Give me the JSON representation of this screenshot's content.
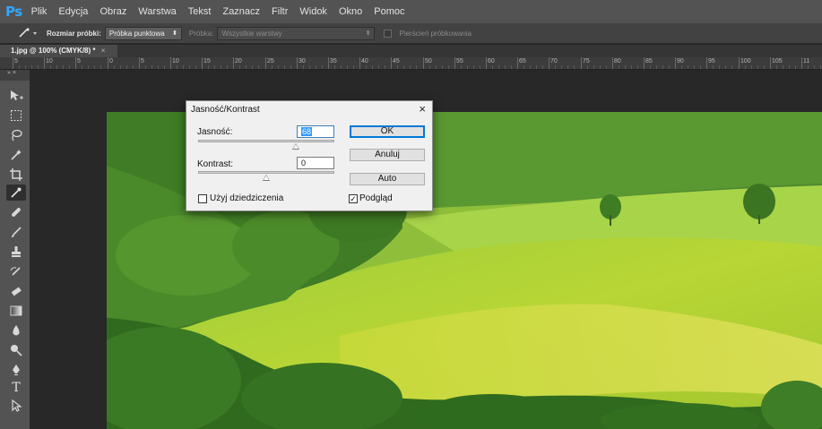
{
  "app": {
    "logo": "Ps"
  },
  "menu": [
    "Plik",
    "Edycja",
    "Obraz",
    "Warstwa",
    "Tekst",
    "Zaznacz",
    "Filtr",
    "Widok",
    "Okno",
    "Pomoc"
  ],
  "options": {
    "sample_size_label": "Rozmiar próbki:",
    "sample_size_value": "Próbka punktowa",
    "sample_label": "Próbka:",
    "sample_value": "Wszystkie warstwy",
    "sampling_ring_label": "Pierścień próbkowania"
  },
  "document": {
    "tab_title": "1.jpg @ 100% (CMYK/8) *",
    "close": "×"
  },
  "ruler": {
    "labels": [
      "5",
      "10",
      "5",
      "0",
      "5",
      "10",
      "15",
      "20",
      "25",
      "30",
      "35",
      "40",
      "45",
      "50",
      "55",
      "60",
      "65",
      "70",
      "75",
      "80",
      "85",
      "90",
      "95",
      "100",
      "105",
      "11"
    ]
  },
  "toolbar": {
    "header": "» ×"
  },
  "dialog": {
    "title": "Jasność/Kontrast",
    "close": "×",
    "brightness_label": "Jasność:",
    "brightness_value": "68",
    "brightness_level": 68,
    "contrast_label": "Kontrast:",
    "contrast_value": "0",
    "contrast_level": 0,
    "ok": "OK",
    "cancel": "Anuluj",
    "auto": "Auto",
    "use_legacy_label": "Użyj dziedziczenia",
    "use_legacy_checked": false,
    "preview_label": "Podgląd",
    "preview_checked": true
  }
}
